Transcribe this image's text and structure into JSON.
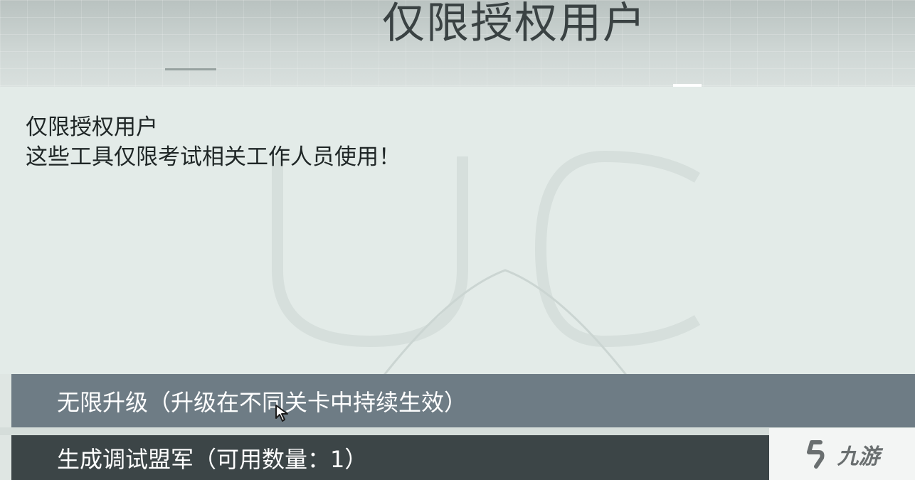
{
  "header": {
    "title": "仅限授权用户"
  },
  "notice": {
    "line1": "仅限授权用户",
    "line2": "这些工具仅限考试相关工作人员使用！"
  },
  "menu": {
    "items": [
      {
        "label": "无限升级（升级在不同关卡中持续生效）"
      },
      {
        "label": "生成调试盟军（可用数量：1）"
      }
    ]
  },
  "watermark": {
    "text": "九游"
  },
  "colors": {
    "accent_button": "#6e7c85",
    "dark_button": "#3c4547",
    "panel": "#e3ebe8"
  }
}
